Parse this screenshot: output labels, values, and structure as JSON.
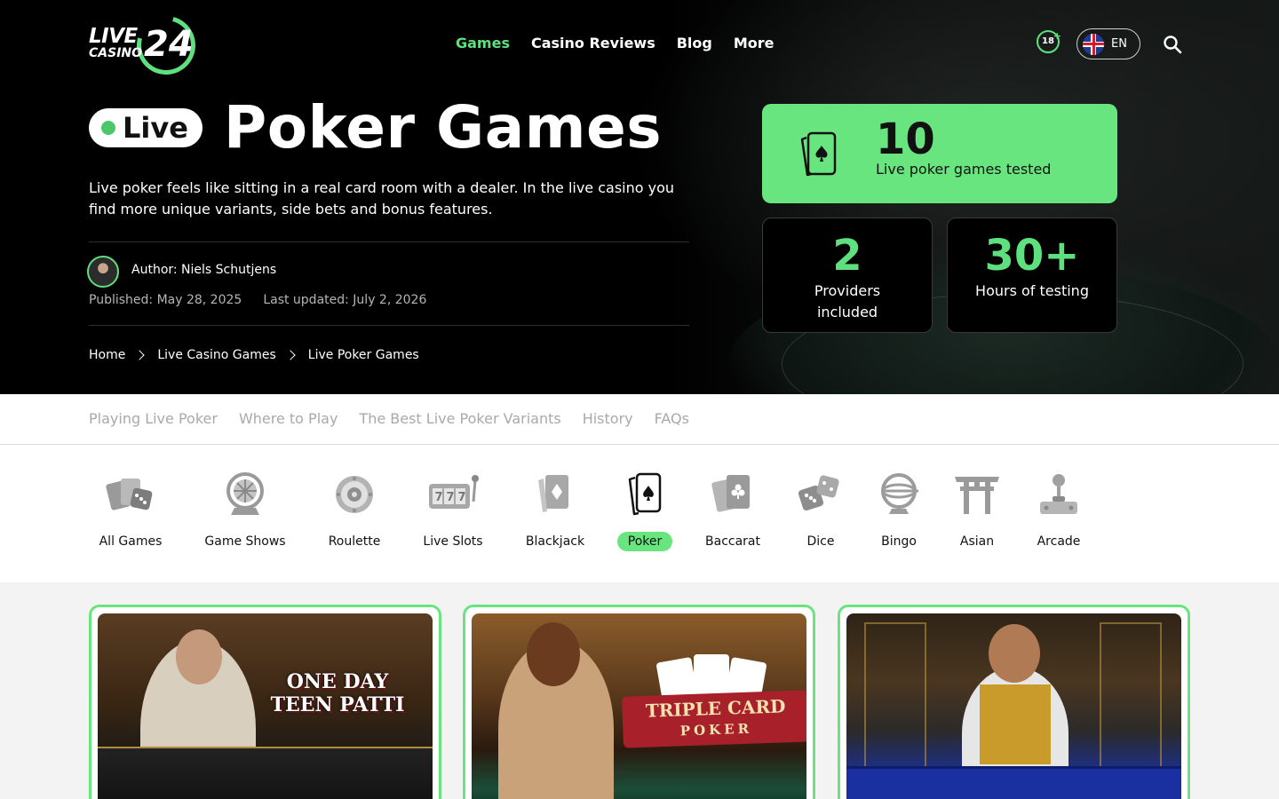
{
  "brand": {
    "logo_live": "LIVE",
    "logo_casino": "CASINO",
    "logo_number": "24"
  },
  "nav": {
    "items": [
      {
        "label": "Games",
        "active": true
      },
      {
        "label": "Casino Reviews",
        "active": false
      },
      {
        "label": "Blog",
        "active": false
      },
      {
        "label": "More",
        "active": false
      }
    ]
  },
  "header_tools": {
    "age_label": "18",
    "age_plus": "+",
    "language": "EN"
  },
  "hero": {
    "badge": "Live",
    "title": "Poker Games",
    "intro": "Live poker feels like sitting in a real card room with a dealer. In the live casino you find more unique variants, side bets and bonus features.",
    "author": "Author: Niels Schutjens",
    "published": "Published: May 28, 2025",
    "updated": "Last updated: July 2, 2026"
  },
  "breadcrumb": [
    "Home",
    "Live Casino Games",
    "Live Poker Games"
  ],
  "stats": {
    "main": {
      "value": "10",
      "label": "Live poker games tested"
    },
    "providers": {
      "value": "2",
      "label_line1": "Providers",
      "label_line2": "included"
    },
    "hours": {
      "value": "30+",
      "label": "Hours of testing"
    }
  },
  "toc": [
    "Playing Live Poker",
    "Where to Play",
    "The Best Live Poker Variants",
    "History",
    "FAQs"
  ],
  "categories": [
    {
      "label": "All Games",
      "icon": "all-games-icon"
    },
    {
      "label": "Game Shows",
      "icon": "game-shows-icon"
    },
    {
      "label": "Roulette",
      "icon": "roulette-icon"
    },
    {
      "label": "Live Slots",
      "icon": "slots-icon"
    },
    {
      "label": "Blackjack",
      "icon": "blackjack-icon"
    },
    {
      "label": "Poker",
      "icon": "poker-icon",
      "active": true
    },
    {
      "label": "Baccarat",
      "icon": "baccarat-icon"
    },
    {
      "label": "Dice",
      "icon": "dice-icon"
    },
    {
      "label": "Bingo",
      "icon": "bingo-icon"
    },
    {
      "label": "Asian",
      "icon": "asian-icon"
    },
    {
      "label": "Arcade",
      "icon": "arcade-icon"
    }
  ],
  "games": [
    {
      "title_line1": "ONE DAY",
      "title_line2": "TEEN PATTI"
    },
    {
      "title_line1": "TRIPLE CARD",
      "title_line2": "POKER"
    },
    {
      "title_line1": "",
      "title_line2": ""
    }
  ],
  "colors": {
    "accent": "#69e57f",
    "accent_text": "#5ee07f",
    "hero_bg": "#000000"
  }
}
